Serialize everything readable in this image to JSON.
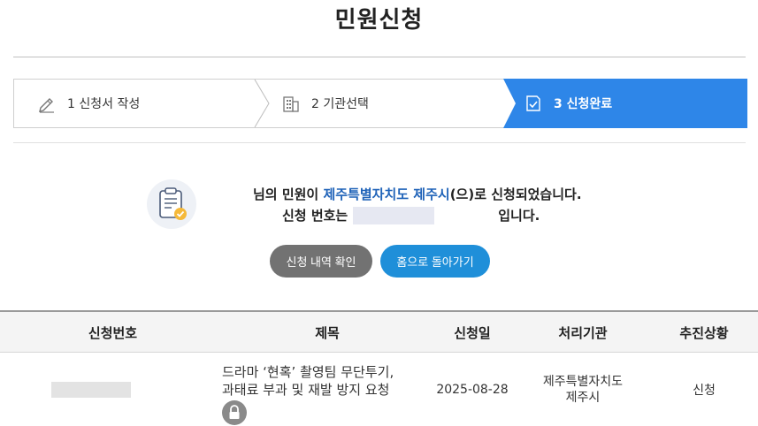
{
  "page": {
    "title": "민원신청"
  },
  "steps": [
    {
      "label": "1 신청서 작성",
      "icon": "pencil-icon"
    },
    {
      "label": "2 기관선택",
      "icon": "building-icon"
    },
    {
      "label": "3 신청완료",
      "icon": "document-check-icon",
      "active": true
    }
  ],
  "colors": {
    "active_step": "#2e86e8",
    "highlight_text": "#1e62b8",
    "btn_history": "#727272",
    "btn_home": "#1f8fd9"
  },
  "message": {
    "line1_prefix": "님의 민원이 ",
    "line1_org": "제주특별자치도 제주시",
    "line1_suffix": "(으)로 신청되었습니다.",
    "line2_prefix": "신청 번호는",
    "line2_suffix": "입니다."
  },
  "buttons": {
    "history": "신청 내역 확인",
    "home": "홈으로 돌아가기"
  },
  "table": {
    "headers": [
      "신청번호",
      "제목",
      "신청일",
      "처리기관",
      "추진상황"
    ],
    "rows": [
      {
        "title_line1": "드라마 ‘현혹’ 촬영팀 무단투기,",
        "title_line2": "과태료 부과 및 재발 방지 요청",
        "date": "2025-08-28",
        "org_line1": "제주특별자치도",
        "org_line2": "제주시",
        "status": "신청"
      }
    ]
  }
}
